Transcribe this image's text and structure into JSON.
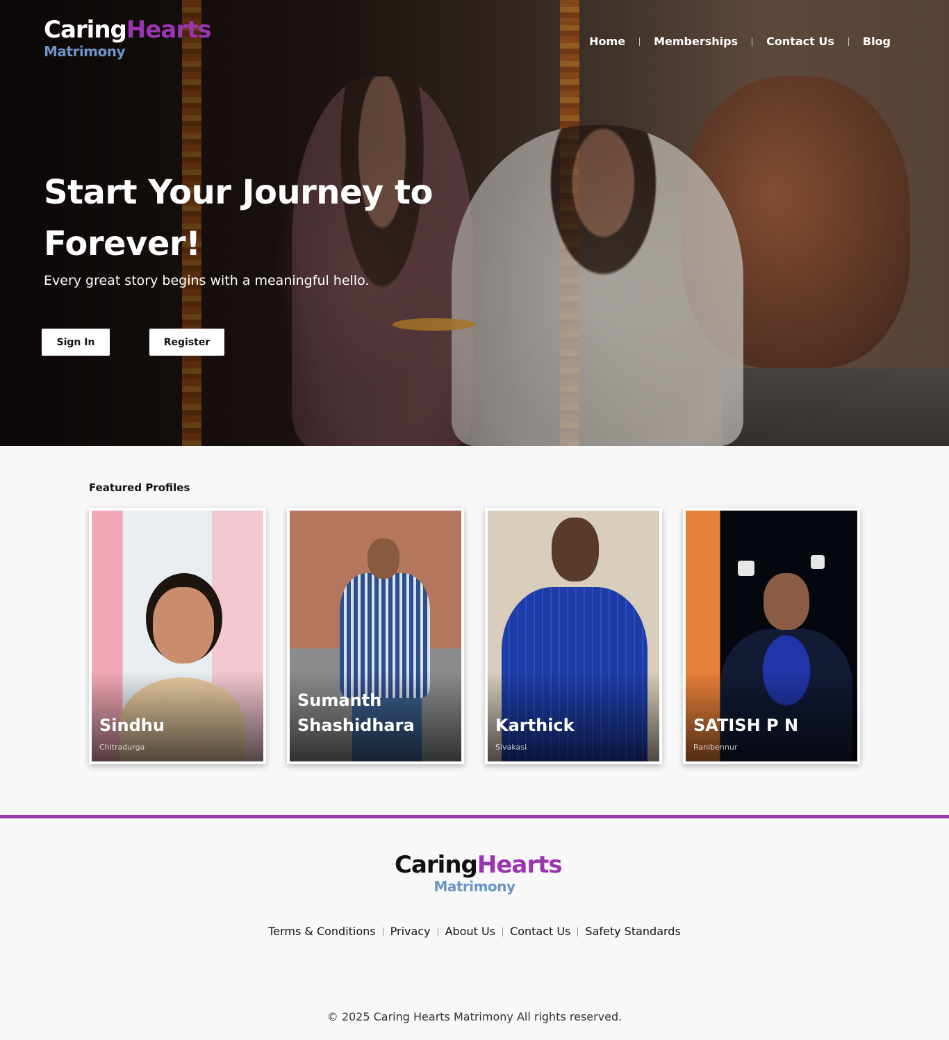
{
  "brand": {
    "name_part1": "Caring",
    "name_part2": "Hearts",
    "tagline": "Matrimony",
    "colors": {
      "hearts": "#9a35b0",
      "tagline": "#6d95c8",
      "accent_line": "#9a35b0"
    }
  },
  "nav": {
    "items": [
      {
        "label": "Home"
      },
      {
        "label": "Memberships"
      },
      {
        "label": "Contact Us"
      },
      {
        "label": "Blog"
      }
    ]
  },
  "hero": {
    "title": "Start Your Journey to Forever!",
    "subtitle": "Every great story begins with a meaningful hello.",
    "signin_label": "Sign In",
    "register_label": "Register"
  },
  "featured": {
    "heading": "Featured Profiles",
    "profiles": [
      {
        "name": "Sindhu",
        "city": "Chitradurga"
      },
      {
        "name": "Sumanth Shashidhara",
        "city": ""
      },
      {
        "name": "Karthick",
        "city": "Sivakasi"
      },
      {
        "name": "SATISH P N",
        "city": "Ranibennur"
      }
    ]
  },
  "footer": {
    "links": [
      {
        "label": "Terms & Conditions"
      },
      {
        "label": "Privacy"
      },
      {
        "label": "About Us"
      },
      {
        "label": "Contact Us"
      },
      {
        "label": "Safety Standards"
      }
    ],
    "copyright": "© 2025 Caring Hearts Matrimony All rights reserved."
  }
}
